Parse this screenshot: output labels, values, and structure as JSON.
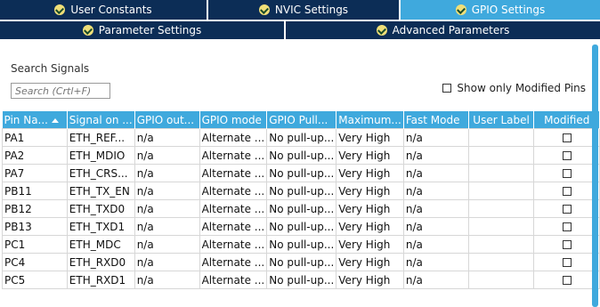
{
  "tabs_top": [
    {
      "label": "User Constants",
      "active": false
    },
    {
      "label": "NVIC Settings",
      "active": false
    },
    {
      "label": "GPIO Settings",
      "active": true
    }
  ],
  "tabs_sub": [
    {
      "label": "Parameter Settings"
    },
    {
      "label": "Advanced Parameters"
    }
  ],
  "search": {
    "label": "Search Signals",
    "placeholder": "Search (Crtl+F)"
  },
  "show_modified": {
    "label": "Show only Modified Pins",
    "checked": false
  },
  "table": {
    "headers": [
      "Pin Na...",
      "Signal on ...",
      "GPIO out...",
      "GPIO mode",
      "GPIO Pull...",
      "Maximum...",
      "Fast Mode",
      "User Label",
      "Modified"
    ],
    "rows": [
      [
        "PA1",
        "ETH_REF...",
        "n/a",
        "Alternate ...",
        "No pull-up...",
        "Very High",
        "n/a",
        "",
        false
      ],
      [
        "PA2",
        "ETH_MDIO",
        "n/a",
        "Alternate ...",
        "No pull-up...",
        "Very High",
        "n/a",
        "",
        false
      ],
      [
        "PA7",
        "ETH_CRS...",
        "n/a",
        "Alternate ...",
        "No pull-up...",
        "Very High",
        "n/a",
        "",
        false
      ],
      [
        "PB11",
        "ETH_TX_EN",
        "n/a",
        "Alternate ...",
        "No pull-up...",
        "Very High",
        "n/a",
        "",
        false
      ],
      [
        "PB12",
        "ETH_TXD0",
        "n/a",
        "Alternate ...",
        "No pull-up...",
        "Very High",
        "n/a",
        "",
        false
      ],
      [
        "PB13",
        "ETH_TXD1",
        "n/a",
        "Alternate ...",
        "No pull-up...",
        "Very High",
        "n/a",
        "",
        false
      ],
      [
        "PC1",
        "ETH_MDC",
        "n/a",
        "Alternate ...",
        "No pull-up...",
        "Very High",
        "n/a",
        "",
        false
      ],
      [
        "PC4",
        "ETH_RXD0",
        "n/a",
        "Alternate ...",
        "No pull-up...",
        "Very High",
        "n/a",
        "",
        false
      ],
      [
        "PC5",
        "ETH_RXD1",
        "n/a",
        "Alternate ...",
        "No pull-up...",
        "Very High",
        "n/a",
        "",
        false
      ]
    ]
  },
  "colors": {
    "tab_bg": "#0c2d56",
    "tab_active": "#3fa9dd",
    "header_bg": "#3fa9dd",
    "check_badge": "#f0df78"
  }
}
